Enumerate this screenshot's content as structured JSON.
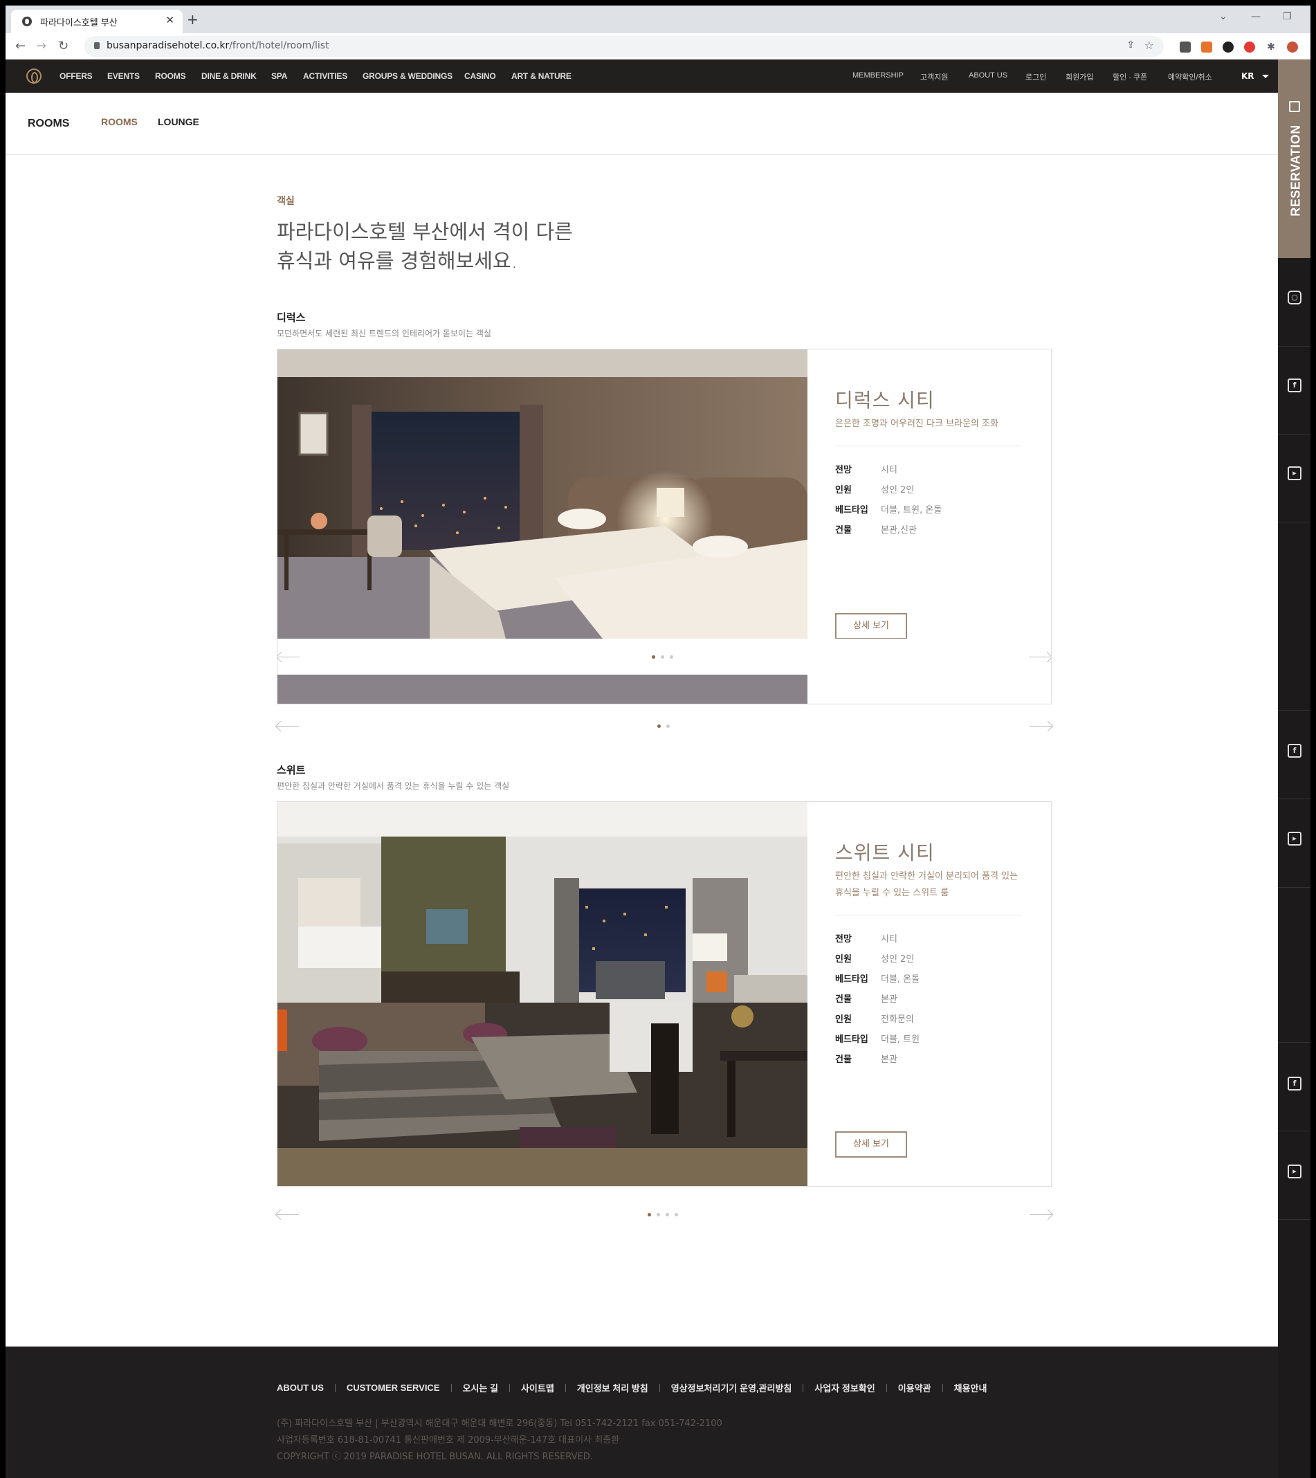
{
  "browser": {
    "tab_title": "파라다이스호텔 부산",
    "url_domain": "busanparadisehotel.co.kr",
    "url_path": "/front/hotel/room/list"
  },
  "nav": {
    "left": [
      "OFFERS",
      "EVENTS",
      "ROOMS",
      "DINE & DRINK",
      "SPA",
      "ACTIVITIES",
      "GROUPS & WEDDINGS",
      "CASINO",
      "ART & NATURE"
    ],
    "right": [
      "MEMBERSHIP",
      "고객지원",
      "ABOUT US",
      "로그인",
      "회원가입",
      "할인 · 쿠폰",
      "예약확인/취소"
    ],
    "lang": "KR"
  },
  "subnav": {
    "title": "ROOMS",
    "items": [
      "ROOMS",
      "LOUNGE"
    ],
    "active": "ROOMS"
  },
  "reservation_label": "RESERVATION",
  "page": {
    "label": "객실",
    "headline_1": "파라다이스호텔 부산에서 격이 다른",
    "headline_2": "휴식과 여유를 경험해보세요."
  },
  "sections": [
    {
      "title": "디럭스",
      "desc": "모던하면서도 세련된 최신 트렌드의 인테리어가 돋보이는 객실",
      "room": {
        "name": "디럭스 시티",
        "desc": "은은한 조명과 어우러진 다크 브라운의 조화",
        "specs": [
          {
            "k": "전망",
            "v": "시티"
          },
          {
            "k": "인원",
            "v": "성인 2인"
          },
          {
            "k": "베드타입",
            "v": "더블, 트윈, 온돌"
          },
          {
            "k": "건물",
            "v": "본관,신관"
          }
        ],
        "button": "상세 보기"
      }
    },
    {
      "title": "스위트",
      "desc": "편안한 침실과 안락한 거실에서 품격 있는 휴식을 누릴 수 있는 객실",
      "room": {
        "name": "스위트 시티",
        "desc": "편안한 침실과 안락한 거실이 분리되어 품격 있는 휴식을 누릴 수 있는 스위트 룸",
        "specs": [
          {
            "k": "전망",
            "v": "시티"
          },
          {
            "k": "인원",
            "v": "성인 2인"
          },
          {
            "k": "베드타입",
            "v": "더블, 온돌"
          },
          {
            "k": "건물",
            "v": "본관"
          }
        ],
        "specs_overlay": [
          {
            "k": "인원",
            "v": "전화문의"
          },
          {
            "k": "베드타입",
            "v": "더블, 트윈"
          },
          {
            "k": "건물",
            "v": "본관"
          }
        ],
        "button": "상세 보기"
      }
    }
  ],
  "footer": {
    "links": [
      "ABOUT US",
      "CUSTOMER SERVICE",
      "오시는 길",
      "사이트맵",
      "개인정보 처리 방침",
      "영상정보처리기기 운영,관리방침",
      "사업자 정보확인",
      "이용약관",
      "채용안내"
    ],
    "address_1": "(주) 파라다이스호텔 부산 | 부산광역시 해운대구 해운대 해변로 296(중동) Tel 051-742-2121 fax 051-742-2100",
    "address_2": "사업자등록번호 618-81-00741 통신판매번호 제 2009-부산해운-147호 대표이사 최종환",
    "copyright": "COPYRIGHT ⓒ 2019 PARADISE HOTEL BUSAN. ALL RIGHTS RESERVED."
  },
  "colors": {
    "accent": "#8c6b4f",
    "nav_bg": "#221f1f",
    "reservation_bg": "#8c7a6b",
    "footer_bg": "#201e1e"
  }
}
